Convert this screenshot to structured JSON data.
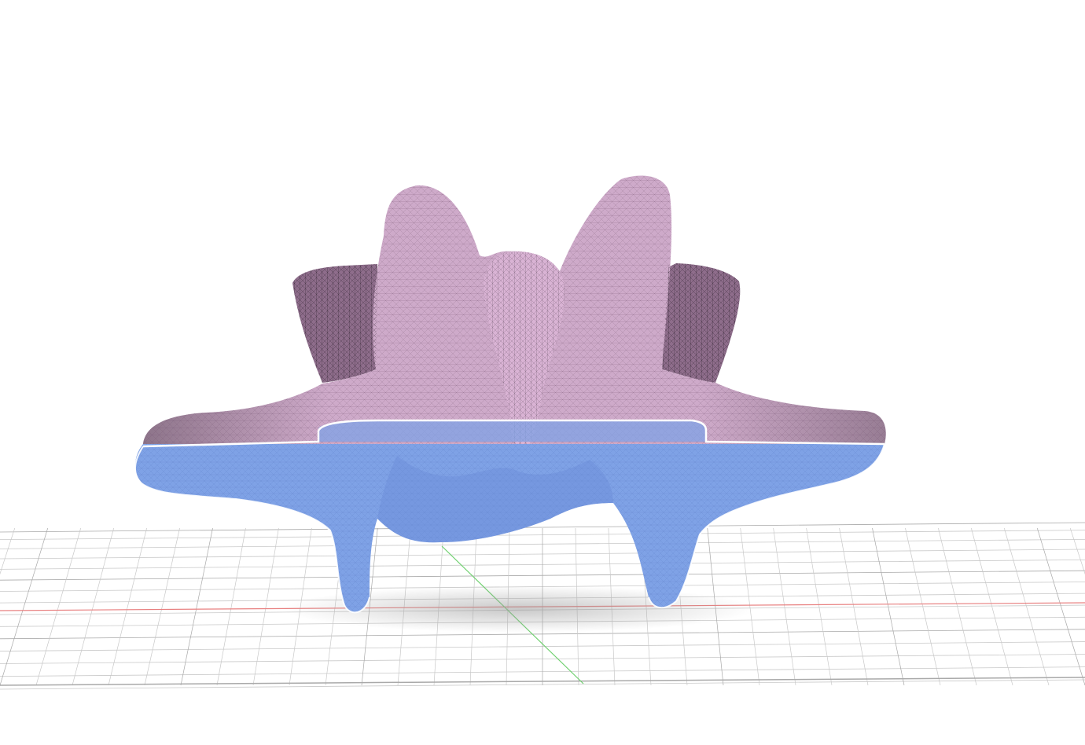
{
  "viewport": {
    "background": "#ffffff",
    "mode": "3d-mesh-viewer"
  },
  "scene": {
    "grid": {
      "visible": true,
      "line_color": "#c9c9c9",
      "major_color": "#a9a9a9"
    },
    "axes": {
      "x_axis_color": "#e88080",
      "y_axis_color": "#6fd06f"
    },
    "model": {
      "name": "vertebra-mesh",
      "wireframe": true,
      "upper_color": "#d9b3d4",
      "upper_shadow_color": "#8e6d8b",
      "lower_color": "#7fa2e6",
      "lower_dark_color": "#6886d3",
      "outline_color": "#ffffff"
    },
    "shadow_color": "#9c9c9c"
  }
}
